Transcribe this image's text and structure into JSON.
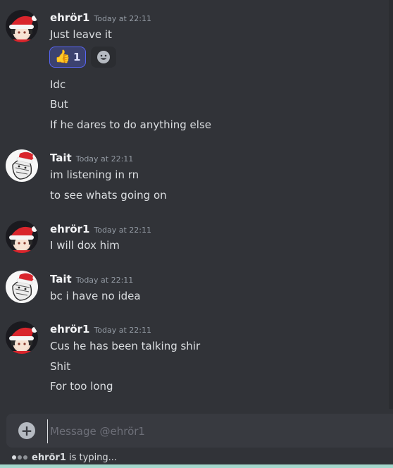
{
  "messages": [
    {
      "username": "ehrör1",
      "timestamp": "Today at 22:11",
      "lines": [
        "Just leave it",
        "Idc",
        "But",
        "If he dares to do anything else"
      ],
      "reaction": {
        "emoji": "👍",
        "count": "1"
      }
    },
    {
      "username": "Tait",
      "timestamp": "Today at 22:11",
      "lines": [
        "im listening in rn",
        "to see whats going on"
      ]
    },
    {
      "username": "ehrör1",
      "timestamp": "Today at 22:11",
      "lines": [
        "I will dox him"
      ]
    },
    {
      "username": "Tait",
      "timestamp": "Today at 22:11",
      "lines": [
        "bc i have no idea"
      ]
    },
    {
      "username": "ehrör1",
      "timestamp": "Today at 22:11",
      "lines": [
        "Cus he has been talking shir",
        "Shit",
        "For too long"
      ]
    }
  ],
  "composer": {
    "placeholder": "Message @ehrör1",
    "plus": "+"
  },
  "typing": {
    "user": "ehrör1",
    "text": " is typing..."
  },
  "colors": {
    "background": "#313338",
    "composer": "#383a40",
    "reaction_border": "#5865f2",
    "reaction_bg": "#3c4270",
    "accent_bar": "#a4d8cc"
  }
}
